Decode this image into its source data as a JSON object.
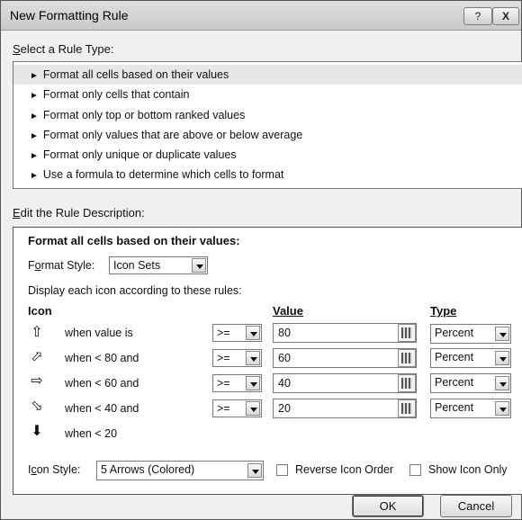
{
  "dialog": {
    "title": "New Formatting Rule",
    "help_label": "?",
    "close_label": "X"
  },
  "rule_type": {
    "label_prefix": "S",
    "label_rest": "elect a Rule Type:",
    "items": [
      {
        "label": "Format all cells based on their values",
        "selected": true
      },
      {
        "label": "Format only cells that contain"
      },
      {
        "label": "Format only top or bottom ranked values"
      },
      {
        "label": "Format only values that are above or below average"
      },
      {
        "label": "Format only unique or duplicate values"
      },
      {
        "label": "Use a formula to determine which cells to format"
      }
    ],
    "item_marker": "►"
  },
  "description": {
    "label_prefix": "E",
    "label_rest": "dit the Rule Description:",
    "title": "Format all cells based on their values:",
    "format_style_label_a": "F",
    "format_style_label_u": "o",
    "format_style_label_b": "rmat Style:",
    "format_style_value": "Icon Sets",
    "display_text": "Display each icon according to these rules:",
    "headers": {
      "icon": "Icon",
      "value": "Value",
      "type": "Type"
    },
    "rows": [
      {
        "icon": "up-arrow-icon",
        "glyph": "⇧",
        "condition": "when value is",
        "operator": ">=",
        "value": "80",
        "type": "Percent"
      },
      {
        "icon": "up-right-arrow-icon",
        "glyph": "⬀",
        "condition": "when < 80 and",
        "operator": ">=",
        "value": "60",
        "type": "Percent"
      },
      {
        "icon": "right-arrow-icon",
        "glyph": "⇨",
        "condition": "when < 60 and",
        "operator": ">=",
        "value": "40",
        "type": "Percent"
      },
      {
        "icon": "down-right-arrow-icon",
        "glyph": "⬂",
        "condition": "when < 40 and",
        "operator": ">=",
        "value": "20",
        "type": "Percent"
      },
      {
        "icon": "down-arrow-icon",
        "glyph": "⬇",
        "condition": "when < 20"
      }
    ],
    "icon_style_label_a": "I",
    "icon_style_label_u": "c",
    "icon_style_label_b": "on Style:",
    "icon_style_value": "5 Arrows (Colored)",
    "reverse_label": "Reverse Icon Order",
    "show_icon_only_label": "Show Icon Only"
  },
  "buttons": {
    "ok": "OK",
    "cancel": "Cancel"
  }
}
